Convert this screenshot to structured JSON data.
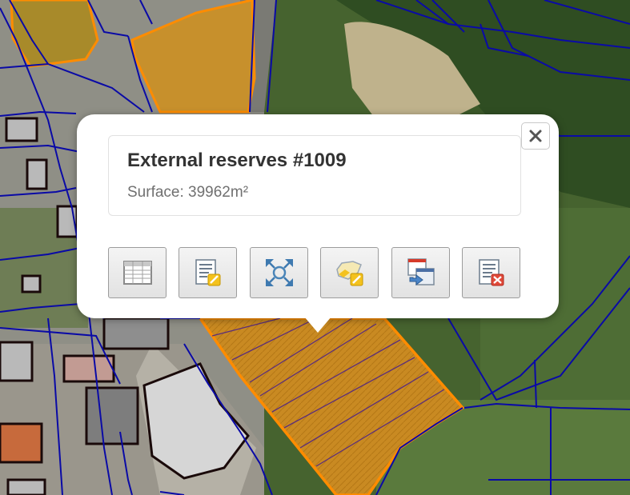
{
  "popup": {
    "title": "External reserves #1009",
    "surface": "Surface: 39962m²",
    "close_symbol": "×",
    "tools": [
      {
        "name": "attribute-table-icon"
      },
      {
        "name": "edit-attributes-icon"
      },
      {
        "name": "zoom-to-feature-icon"
      },
      {
        "name": "edit-geometry-icon"
      },
      {
        "name": "transfer-feature-icon"
      },
      {
        "name": "delete-feature-icon"
      }
    ]
  },
  "colors": {
    "parcel_line": "#0a0aa6",
    "highlight_outline": "#ff8c00",
    "selected_fill": "#d18a1c",
    "building_outline": "#1a0a0a"
  }
}
